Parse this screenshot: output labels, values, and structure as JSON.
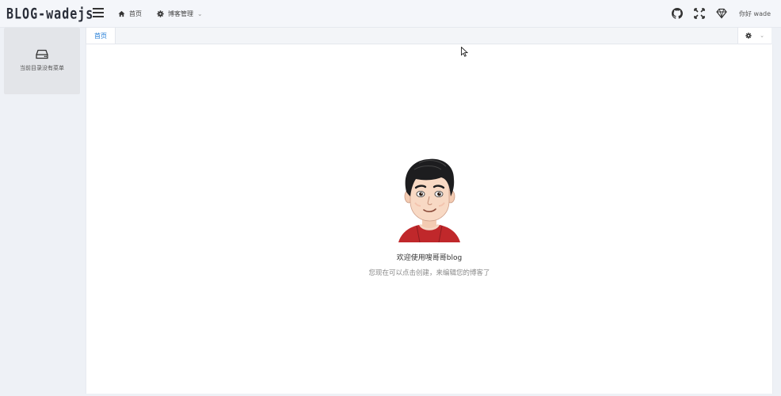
{
  "header": {
    "logo": "BLOG-wadejs",
    "nav": [
      {
        "label": "首页",
        "icon": "home-icon"
      },
      {
        "label": "博客管理",
        "icon": "gear-icon",
        "caret": "chevron-down-icon"
      }
    ],
    "right_icons": [
      "github-icon",
      "fullscreen-icon",
      "diamond-icon"
    ],
    "greeting": "你好 wade"
  },
  "sidebar": {
    "icon": "drive-icon",
    "empty_text": "当前目录没有菜单"
  },
  "tabs": {
    "items": [
      {
        "label": "首页",
        "active": true
      }
    ],
    "settings_icon": "gear-icon"
  },
  "main": {
    "welcome_title": "欢迎使用嗖哥哥blog",
    "welcome_subtitle": "您现在可以点击创建，来编辑您的博客了"
  },
  "colors": {
    "accent": "#1e7ad6",
    "background": "#eef1f6",
    "sidebar_bg": "#e3e5e9"
  }
}
